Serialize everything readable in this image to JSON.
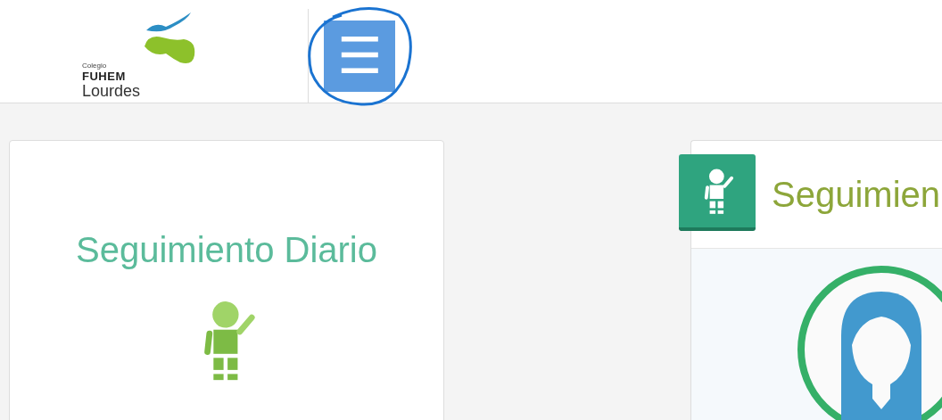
{
  "header": {
    "logo": {
      "line_1": "Colegio",
      "line_2": "FUHEM",
      "line_3": "Lourdes"
    },
    "menu_button": {
      "icon": "☰",
      "highlighted": true
    }
  },
  "cards": [
    {
      "kind": "tile",
      "title": "Seguimiento Diario"
    },
    {
      "kind": "profile",
      "title": "Seguimien"
    }
  ]
}
